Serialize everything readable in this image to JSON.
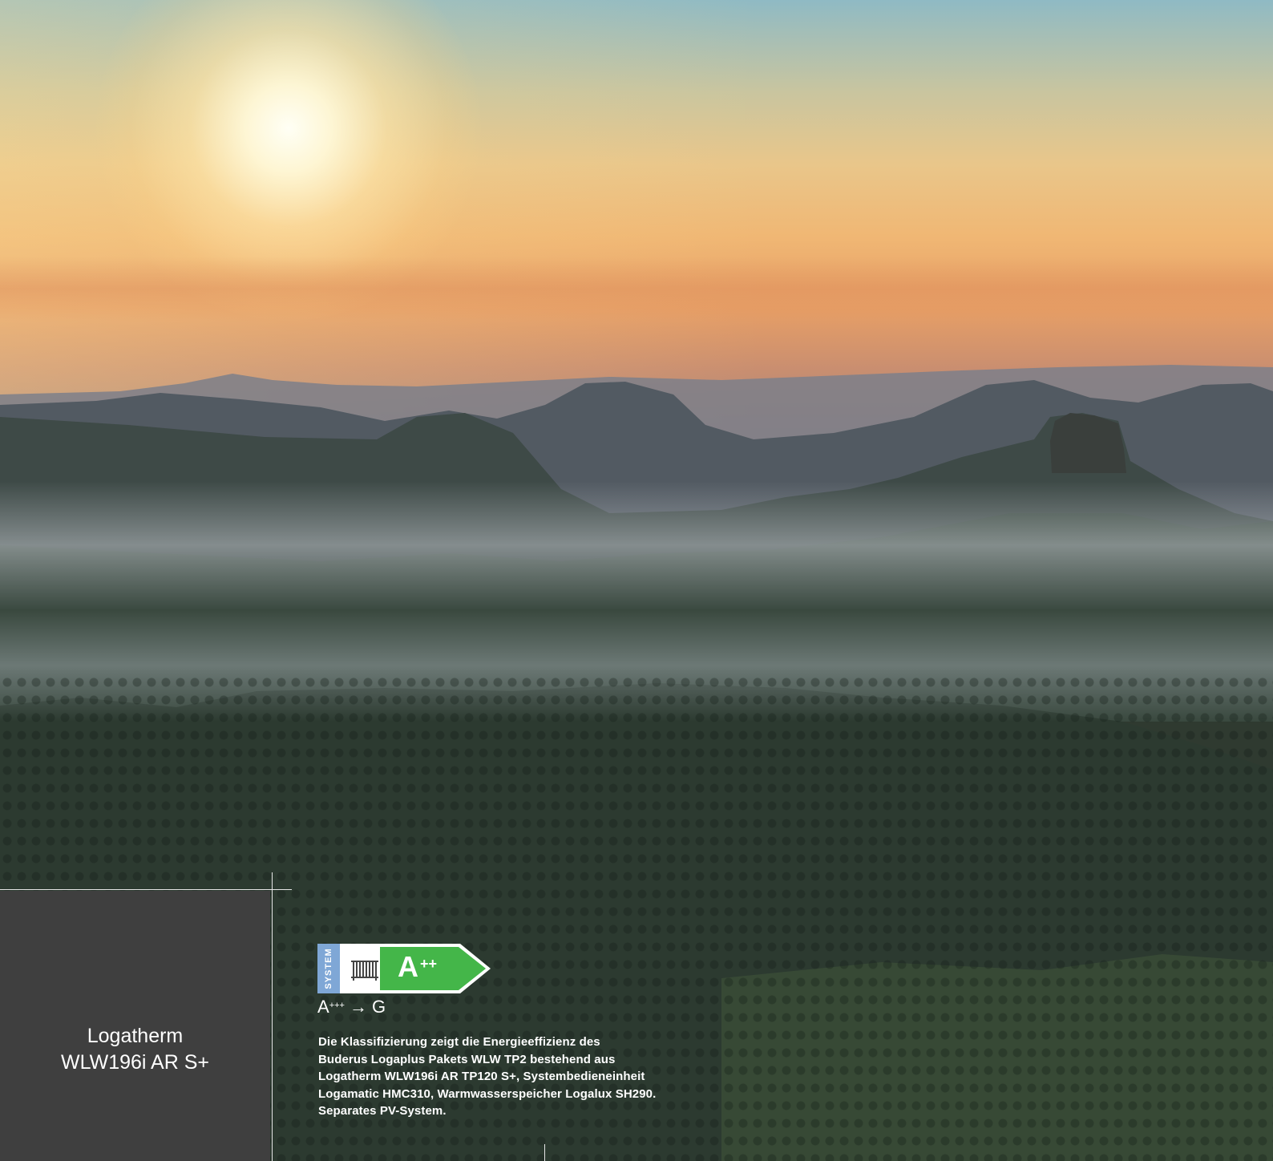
{
  "product": {
    "title_line1": "Logatherm",
    "title_line2": "WLW196i AR S+"
  },
  "energy_label": {
    "system_tag": "SYSTEM",
    "icon": "radiator-icon",
    "class": "A",
    "class_superscript": "++",
    "scale_start": "A",
    "scale_start_superscript": "+++",
    "scale_arrow": "→",
    "scale_end": "G",
    "colors": {
      "system_blue": "#7fa7d6",
      "class_green": "#44b649",
      "border_white": "#ffffff"
    }
  },
  "description": {
    "line1": "Die Klassifizierung zeigt die Energieeffizienz des",
    "line2": "Buderus Logaplus Pakets WLW TP2 bestehend aus",
    "line3": "Logatherm WLW196i AR TP120 S+, Systembedieneinheit",
    "line4": "Logamatic HMC310, Warmwasserspeicher Logalux SH290.",
    "line5": "Separates PV-System."
  },
  "colors": {
    "panel": "#3f3f3f",
    "text": "#ffffff"
  }
}
